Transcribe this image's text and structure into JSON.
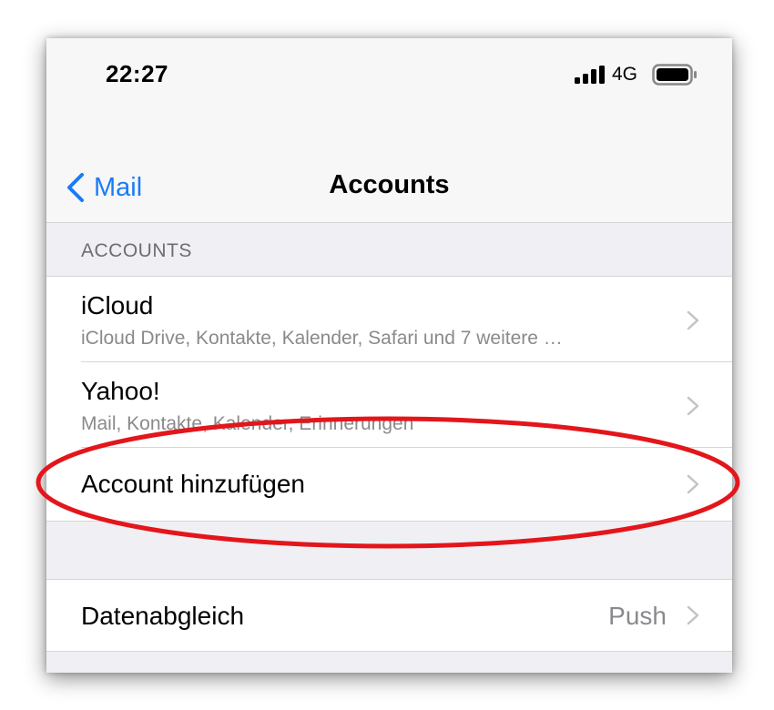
{
  "status_bar": {
    "time": "22:27",
    "network": "4G",
    "icons": [
      "cellular-signal-icon",
      "battery-icon"
    ]
  },
  "nav": {
    "back_label": "Mail",
    "title": "Accounts",
    "accent_color": "#1a7cf5"
  },
  "accounts_section": {
    "header": "ACCOUNTS",
    "items": [
      {
        "title": "iCloud",
        "subtitle": "iCloud Drive, Kontakte, Kalender, Safari und 7 weitere …"
      },
      {
        "title": "Yahoo!",
        "subtitle": "Mail, Kontakte, Kalender, Erinnerungen"
      },
      {
        "title": "Account hinzufügen"
      }
    ]
  },
  "fetch_section": {
    "title": "Datenabgleich",
    "value": "Push"
  },
  "annotation": {
    "shape": "ellipse",
    "color": "#e3161b",
    "highlights": "Account hinzufügen"
  }
}
